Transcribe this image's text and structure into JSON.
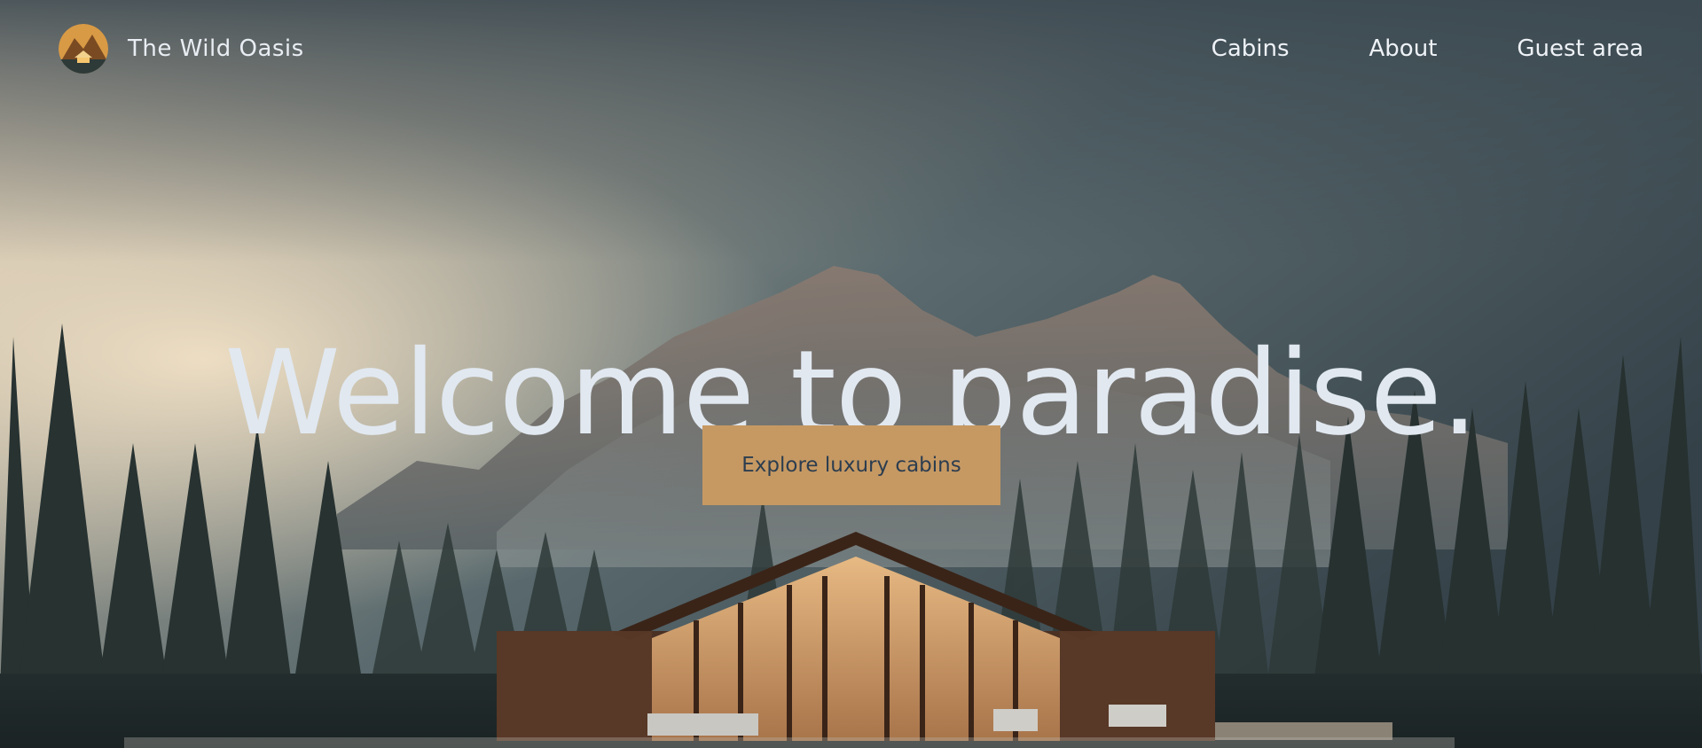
{
  "brand": {
    "name": "The Wild Oasis",
    "logo_icon": "cabin-mountain-logo-icon"
  },
  "nav": [
    {
      "label": "Cabins"
    },
    {
      "label": "About"
    },
    {
      "label": "Guest area"
    }
  ],
  "hero": {
    "title": "Welcome to paradise.",
    "cta_label": "Explore luxury cabins"
  },
  "colors": {
    "accent": "#c69963",
    "cta_text": "#2c3d4f",
    "title_text": "#e1e8f0",
    "nav_text": "#eef2f7"
  }
}
